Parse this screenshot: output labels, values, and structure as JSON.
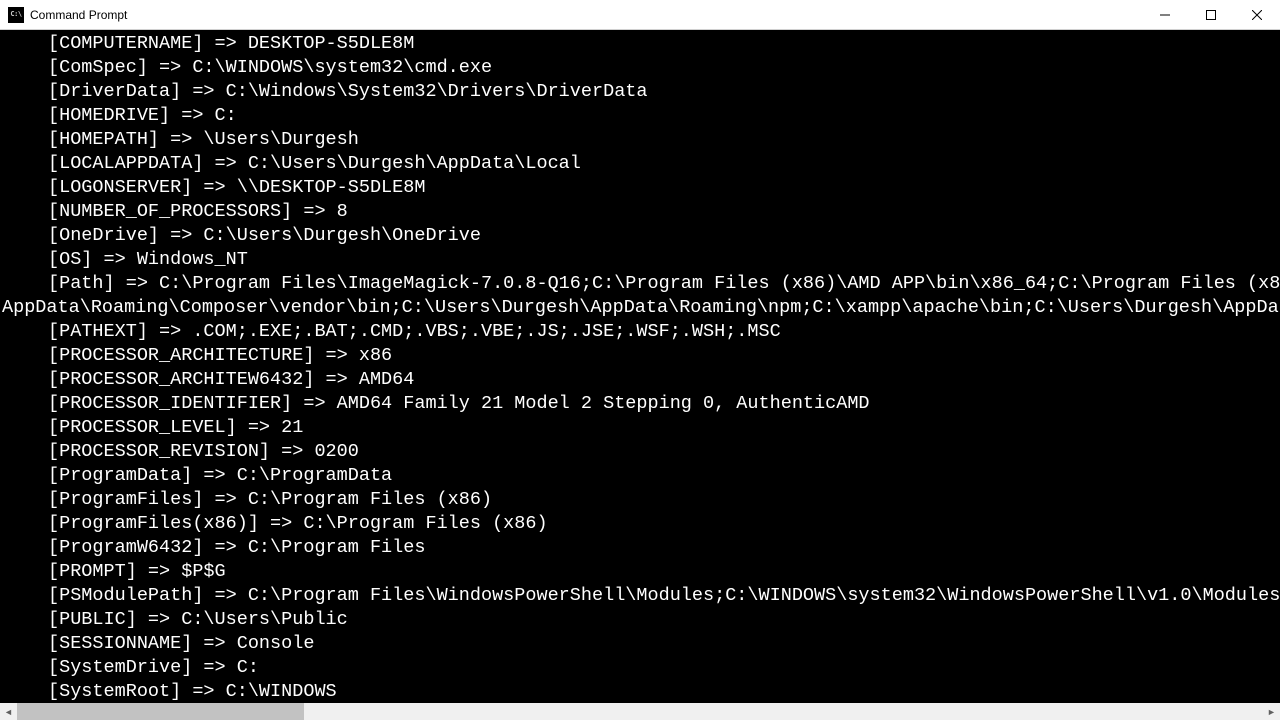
{
  "window": {
    "title": "Command Prompt"
  },
  "lines": [
    {
      "indent": true,
      "text": "[COMPUTERNAME] => DESKTOP-S5DLE8M"
    },
    {
      "indent": true,
      "text": "[ComSpec] => C:\\WINDOWS\\system32\\cmd.exe"
    },
    {
      "indent": true,
      "text": "[DriverData] => C:\\Windows\\System32\\Drivers\\DriverData"
    },
    {
      "indent": true,
      "text": "[HOMEDRIVE] => C:"
    },
    {
      "indent": true,
      "text": "[HOMEPATH] => \\Users\\Durgesh"
    },
    {
      "indent": true,
      "text": "[LOCALAPPDATA] => C:\\Users\\Durgesh\\AppData\\Local"
    },
    {
      "indent": true,
      "text": "[LOGONSERVER] => \\\\DESKTOP-S5DLE8M"
    },
    {
      "indent": true,
      "text": "[NUMBER_OF_PROCESSORS] => 8"
    },
    {
      "indent": true,
      "text": "[OneDrive] => C:\\Users\\Durgesh\\OneDrive"
    },
    {
      "indent": true,
      "text": "[OS] => Windows_NT"
    },
    {
      "indent": true,
      "text": "[Path] => C:\\Program Files\\ImageMagick-7.0.8-Q16;C:\\Program Files (x86)\\AMD APP\\bin\\x86_64;C:\\Program Files (x8"
    },
    {
      "indent": false,
      "text": "AppData\\Roaming\\Composer\\vendor\\bin;C:\\Users\\Durgesh\\AppData\\Roaming\\npm;C:\\xampp\\apache\\bin;C:\\Users\\Durgesh\\AppDa"
    },
    {
      "indent": true,
      "text": "[PATHEXT] => .COM;.EXE;.BAT;.CMD;.VBS;.VBE;.JS;.JSE;.WSF;.WSH;.MSC"
    },
    {
      "indent": true,
      "text": "[PROCESSOR_ARCHITECTURE] => x86"
    },
    {
      "indent": true,
      "text": "[PROCESSOR_ARCHITEW6432] => AMD64"
    },
    {
      "indent": true,
      "text": "[PROCESSOR_IDENTIFIER] => AMD64 Family 21 Model 2 Stepping 0, AuthenticAMD"
    },
    {
      "indent": true,
      "text": "[PROCESSOR_LEVEL] => 21"
    },
    {
      "indent": true,
      "text": "[PROCESSOR_REVISION] => 0200"
    },
    {
      "indent": true,
      "text": "[ProgramData] => C:\\ProgramData"
    },
    {
      "indent": true,
      "text": "[ProgramFiles] => C:\\Program Files (x86)"
    },
    {
      "indent": true,
      "text": "[ProgramFiles(x86)] => C:\\Program Files (x86)"
    },
    {
      "indent": true,
      "text": "[ProgramW6432] => C:\\Program Files"
    },
    {
      "indent": true,
      "text": "[PROMPT] => $P$G"
    },
    {
      "indent": true,
      "text": "[PSModulePath] => C:\\Program Files\\WindowsPowerShell\\Modules;C:\\WINDOWS\\system32\\WindowsPowerShell\\v1.0\\Modules"
    },
    {
      "indent": true,
      "text": "[PUBLIC] => C:\\Users\\Public"
    },
    {
      "indent": true,
      "text": "[SESSIONNAME] => Console"
    },
    {
      "indent": true,
      "text": "[SystemDrive] => C:"
    },
    {
      "indent": true,
      "text": "[SystemRoot] => C:\\WINDOWS"
    }
  ]
}
